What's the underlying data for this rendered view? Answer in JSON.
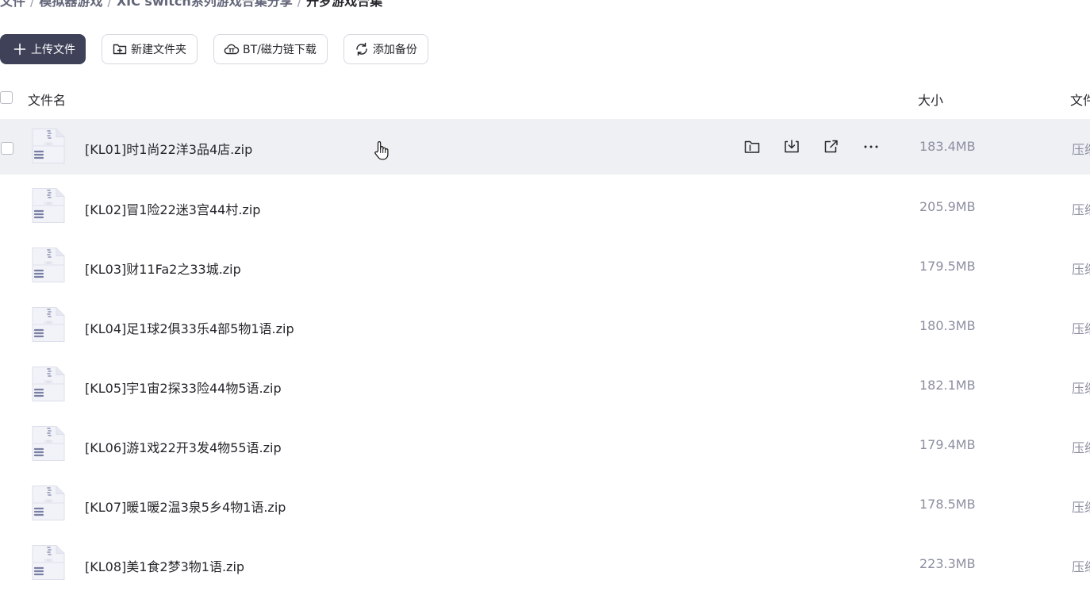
{
  "breadcrumb": {
    "items": [
      "文件",
      "模拟器游戏",
      "XIC switch系列游戏合集分享"
    ],
    "current": "开罗游戏合集",
    "separator": "/"
  },
  "toolbar": {
    "upload_label": "上传文件",
    "new_folder_label": "新建文件夹",
    "bt_label": "BT/磁力链下载",
    "backup_label": "添加备份"
  },
  "table": {
    "headers": {
      "name": "文件名",
      "size": "大小",
      "type": "文件"
    }
  },
  "files": [
    {
      "name": "[KL01]时1尚22洋3品4店.zip",
      "size": "183.4MB",
      "type": "压缩"
    },
    {
      "name": "[KL02]冒1险22迷3宫44村.zip",
      "size": "205.9MB",
      "type": "压缩"
    },
    {
      "name": "[KL03]财11Fa2之33城.zip",
      "size": "179.5MB",
      "type": "压缩"
    },
    {
      "name": "[KL04]足1球2俱33乐4部5物1语.zip",
      "size": "180.3MB",
      "type": "压缩"
    },
    {
      "name": "[KL05]宇1宙2探33险44物5语.zip",
      "size": "182.1MB",
      "type": "压缩"
    },
    {
      "name": "[KL06]游1戏22开3发4物55语.zip",
      "size": "179.4MB",
      "type": "压缩"
    },
    {
      "name": "[KL07]暖1暖2温3泉5乡4物1语.zip",
      "size": "178.5MB",
      "type": "压缩"
    },
    {
      "name": "[KL08]美1食2梦3物1语.zip",
      "size": "223.3MB",
      "type": "压缩"
    }
  ],
  "colors": {
    "primary_button": "#3e4158",
    "hover_row": "#eef0f4",
    "muted_text": "#8c8fa0"
  },
  "icons": {
    "upload": "plus-icon",
    "new_folder": "folder-plus-icon",
    "bt": "bt-cloud-icon",
    "backup": "sync-icon",
    "file": "zip-archive-icon",
    "row_actions": [
      "move-folder-icon",
      "download-icon",
      "share-icon",
      "more-icon"
    ]
  }
}
